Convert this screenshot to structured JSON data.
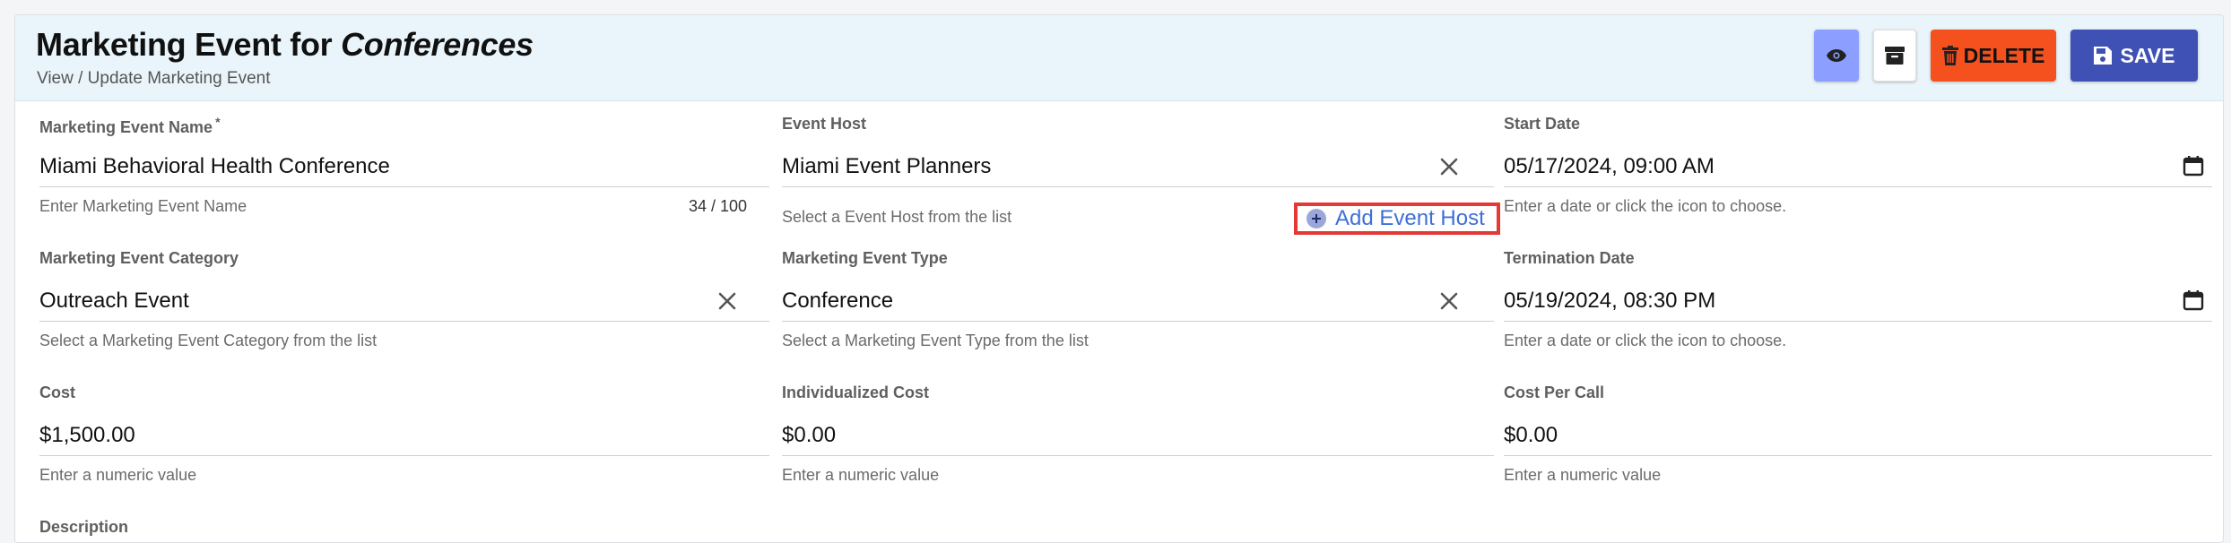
{
  "header": {
    "title_prefix": "Marketing Event for ",
    "title_entity": "Conferences",
    "subtitle": "View / Update Marketing Event",
    "delete_label": "DELETE",
    "save_label": "SAVE"
  },
  "fields": {
    "event_name": {
      "label": "Marketing Event Name",
      "required_mark": "*",
      "value": "Miami Behavioral Health Conference",
      "helper": "Enter Marketing Event Name",
      "counter": "34 / 100"
    },
    "event_host": {
      "label": "Event Host",
      "value": "Miami Event Planners",
      "helper": "Select a Event Host from the list",
      "add_label": "Add Event Host"
    },
    "start_date": {
      "label": "Start Date",
      "value": "05/17/2024, 09:00 AM",
      "helper": "Enter a date or click the icon to choose."
    },
    "category": {
      "label": "Marketing Event Category",
      "value": "Outreach Event",
      "helper": "Select a Marketing Event Category from the list"
    },
    "event_type": {
      "label": "Marketing Event Type",
      "value": "Conference",
      "helper": "Select a Marketing Event Type from the list"
    },
    "termination_date": {
      "label": "Termination Date",
      "value": "05/19/2024, 08:30 PM",
      "helper": "Enter a date or click the icon to choose."
    },
    "cost": {
      "label": "Cost",
      "value": "$1,500.00",
      "helper": "Enter a numeric value"
    },
    "individualized_cost": {
      "label": "Individualized Cost",
      "value": "$0.00",
      "helper": "Enter a numeric value"
    },
    "cost_per_call": {
      "label": "Cost Per Call",
      "value": "$0.00",
      "helper": "Enter a numeric value"
    },
    "description": {
      "label": "Description"
    }
  },
  "icons": {
    "view": "eye-icon",
    "archive": "archive-icon",
    "delete": "trash-icon",
    "save": "floppy-icon",
    "clear": "close-icon",
    "calendar": "calendar-icon",
    "add": "plus-circle-icon"
  },
  "colors": {
    "view_button": "#8c9eff",
    "delete_button": "#f4511e",
    "save_button": "#3f51b5",
    "header_bg": "#eaf5fb",
    "add_link": "#3f6fd8",
    "highlight_border": "#e53935"
  }
}
